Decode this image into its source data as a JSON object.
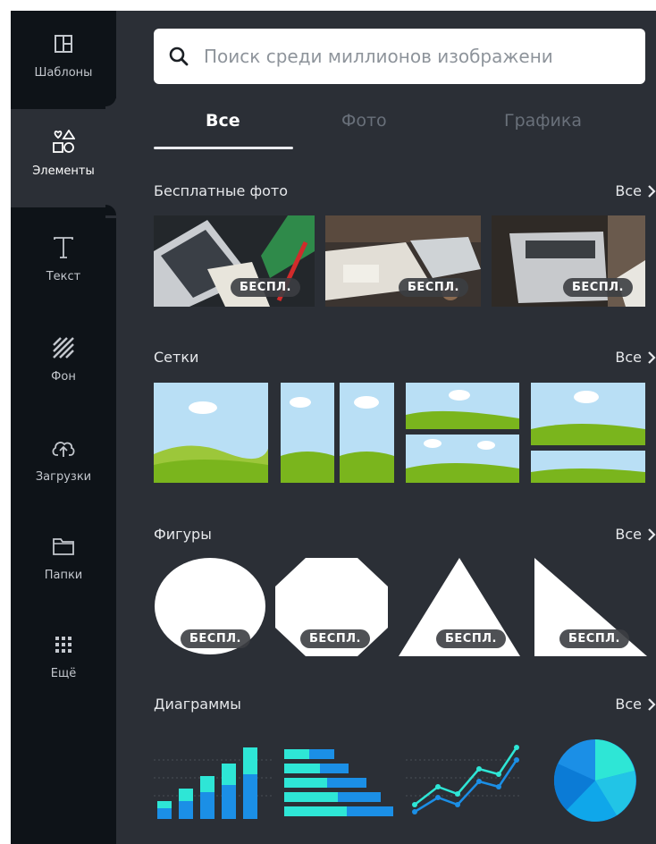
{
  "sidebar": {
    "items": [
      {
        "label": "Шаблоны",
        "icon": "templates-icon"
      },
      {
        "label": "Элементы",
        "icon": "elements-icon"
      },
      {
        "label": "Текст",
        "icon": "text-icon"
      },
      {
        "label": "Фон",
        "icon": "background-icon"
      },
      {
        "label": "Загрузки",
        "icon": "upload-icon"
      },
      {
        "label": "Папки",
        "icon": "folder-icon"
      },
      {
        "label": "Ещё",
        "icon": "more-icon"
      }
    ],
    "active": "Элементы"
  },
  "search": {
    "placeholder": "Поиск среди миллионов изображени"
  },
  "tabs": [
    {
      "label": "Все",
      "active": true
    },
    {
      "label": "Фото",
      "active": false
    },
    {
      "label": "Графика",
      "active": false
    }
  ],
  "sections": {
    "photos": {
      "title": "Бесплатные фото",
      "all": "Все",
      "badge": "БЕСПЛ."
    },
    "grids": {
      "title": "Сетки",
      "all": "Все"
    },
    "shapes": {
      "title": "Фигуры",
      "all": "Все",
      "badge": "БЕСПЛ."
    },
    "charts": {
      "title": "Диаграммы",
      "all": "Все"
    }
  },
  "colors": {
    "sidebar": "#0e1318",
    "panel": "#2b2f36",
    "sky": "#b9dff5",
    "grass": "#7ab51d",
    "chart_teal": "#2ee6d6",
    "chart_blue": "#1b8fe6"
  }
}
